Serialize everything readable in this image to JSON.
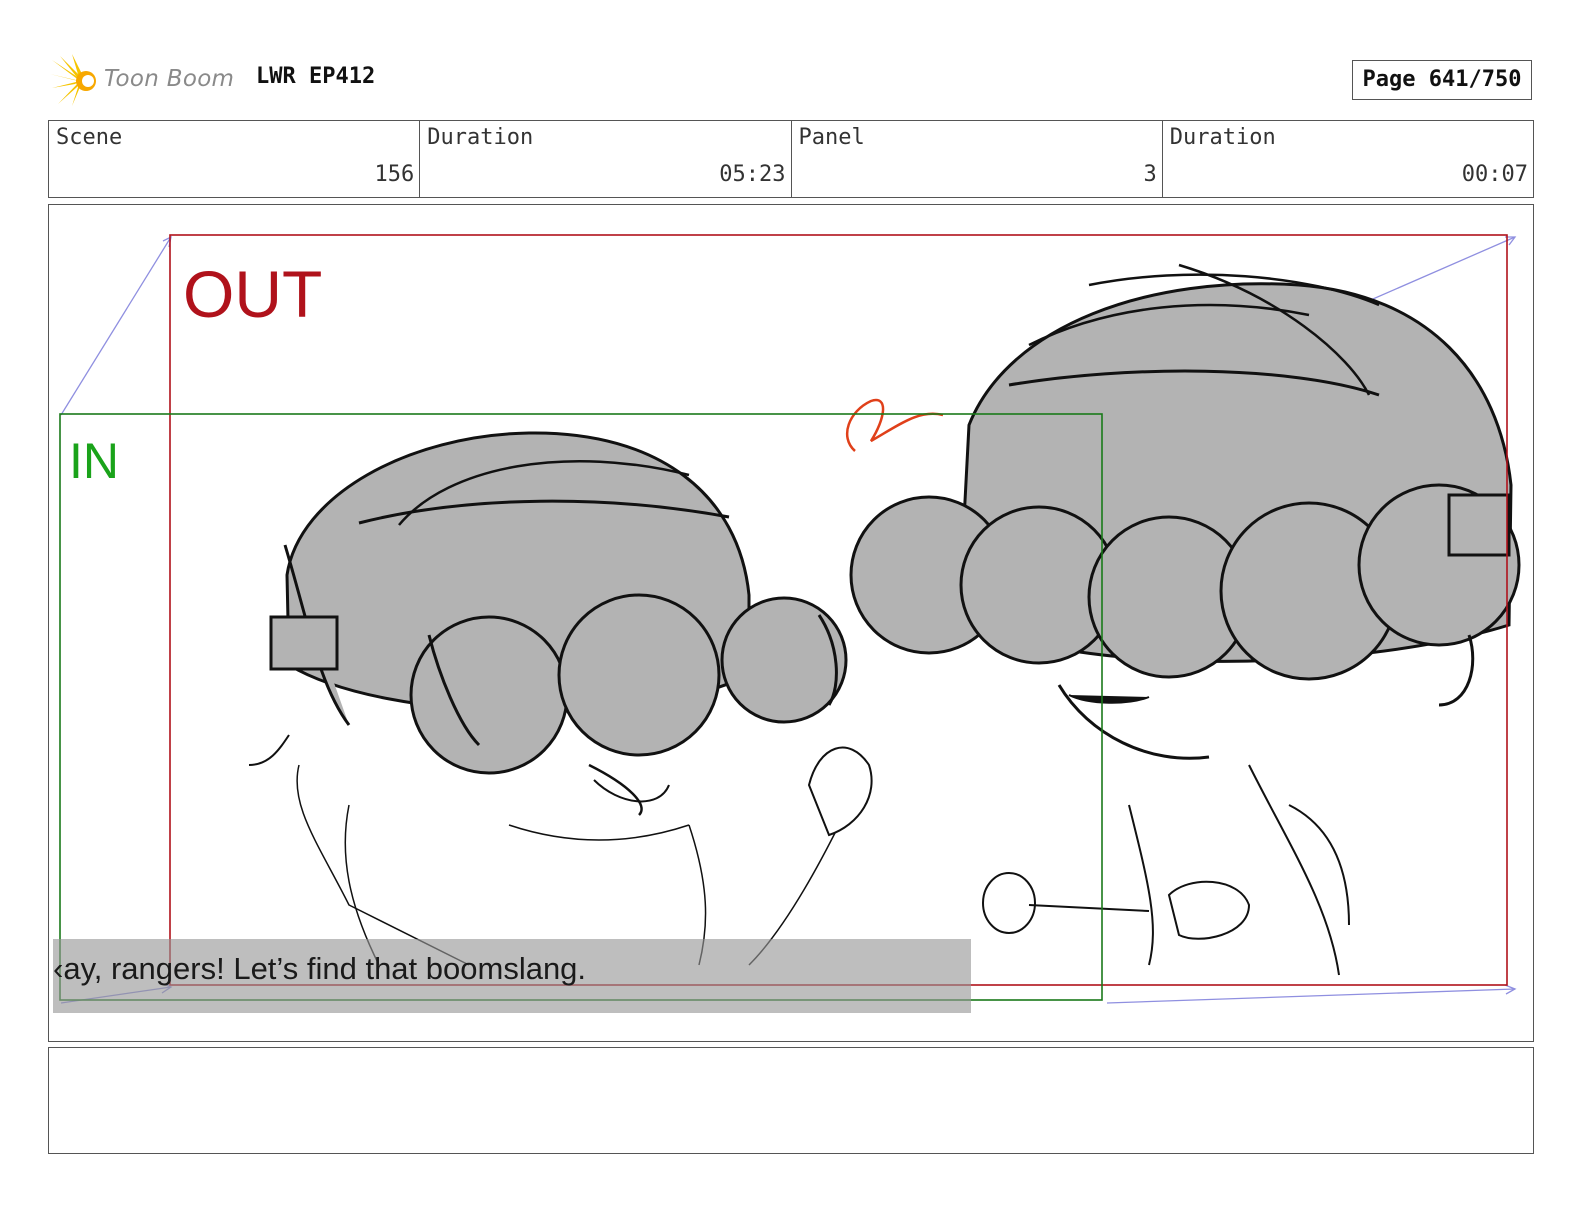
{
  "header": {
    "logo_text": "Toon Boom",
    "project": "LWR EP412",
    "page_label": "Page 641/750"
  },
  "info": {
    "scene_label": "Scene",
    "scene_value": "156",
    "duration_label": "Duration",
    "duration_value": "05:23",
    "panel_label": "Panel",
    "panel_value": "3",
    "panel_duration_label": "Duration",
    "panel_duration_value": "00:07"
  },
  "panel": {
    "out_label": "OUT",
    "in_label": "IN",
    "subtitle": "‹ay, rangers! Let’s find that boomslang.",
    "colors": {
      "out_frame": "#b0121b",
      "in_frame": "#1a7a1a",
      "in_text": "#1aa31a",
      "guide": "#8f8fe0",
      "fill": "#b3b3b3",
      "ink": "#111111",
      "red_mark": "#e0401a"
    }
  },
  "notes": {
    "text": ""
  }
}
